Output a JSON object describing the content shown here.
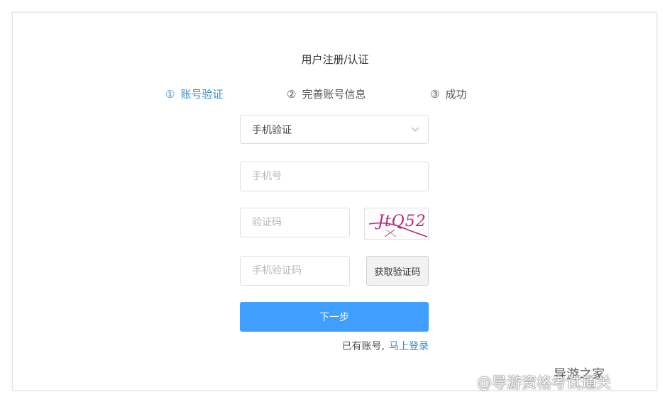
{
  "page": {
    "title": "用户注册/认证"
  },
  "steps": [
    {
      "num": "①",
      "label": "账号验证",
      "active": true
    },
    {
      "num": "②",
      "label": "完善账号信息",
      "active": false
    },
    {
      "num": "③",
      "label": "成功",
      "active": false
    }
  ],
  "form": {
    "verify_method": {
      "value": "手机验证",
      "icon": "chevron-down-icon"
    },
    "phone": {
      "placeholder": "手机号",
      "value": ""
    },
    "captcha_input": {
      "placeholder": "验证码",
      "value": ""
    },
    "captcha_image": {
      "text": "JtQ52"
    },
    "sms_code": {
      "placeholder": "手机验证码",
      "value": ""
    },
    "get_code_label": "获取验证码",
    "next_label": "下一步",
    "has_account_text": "已有账号,",
    "login_link": "马上登录"
  },
  "colors": {
    "accent": "#409eff",
    "link": "#3a8fc7",
    "captcha": "#b52a7c"
  },
  "watermarks": {
    "top": "导游之家",
    "bottom": "@导游资格考试通关"
  }
}
